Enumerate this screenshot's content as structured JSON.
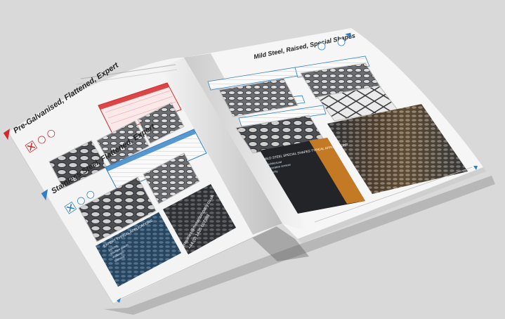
{
  "brochure": {
    "left_page": {
      "section_1_heading": "Pre-Galvanised, Flattened, Expert",
      "section_2_heading": "Stainless Steel, Flattened, Expert",
      "applications_heading": "EXPERT TYPICAL APPLICATIONS",
      "applications_items": [
        "Fencing",
        "Machine guards",
        "Walkways",
        "Shelving"
      ],
      "contact_email": "enquiries@metalcompany.co.uk",
      "contact_phone": "+44 (0) 1425 607388"
    },
    "right_page": {
      "heading": "Mild Steel, Raised, Special Shapes",
      "applications_heading": "MILD STEEL SPECIAL SHAPES TYPICAL APPLICATIONS",
      "applications_items": [
        "Architectural",
        "Decorative screens",
        "Security"
      ]
    }
  },
  "colors": {
    "background": "#d9d9d9",
    "page": "#f4f4f4",
    "accent_red": "#d52a2a",
    "accent_blue": "#2f7fc4",
    "dark_panel": "#24262a",
    "mesh": "#5d5f62"
  }
}
